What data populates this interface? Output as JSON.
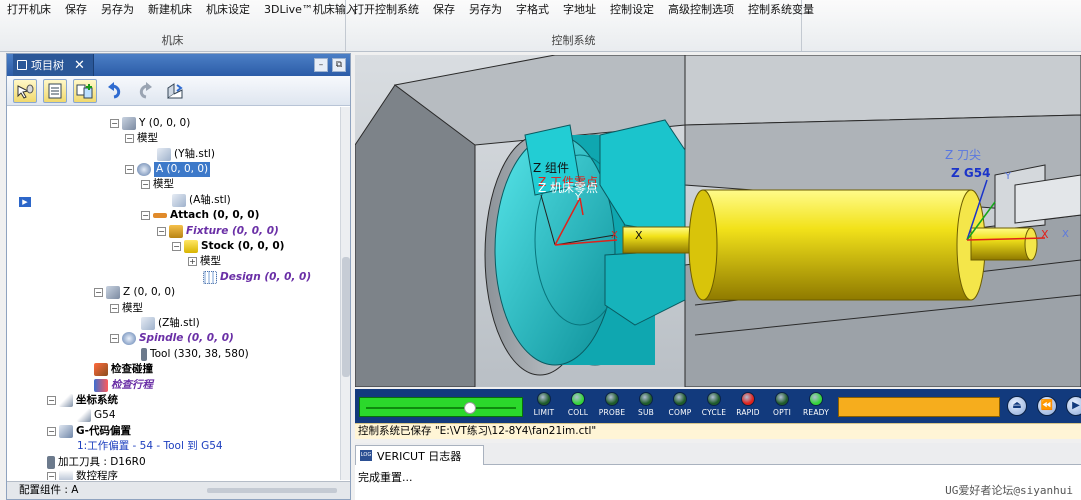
{
  "ribbon": {
    "machine_buttons": [
      "打开机床",
      "保存",
      "另存为",
      "新建机床",
      "机床设定",
      "3DLive™机床输入"
    ],
    "machine_caption": "机床",
    "control_buttons": [
      "打开控制系统",
      "保存",
      "另存为",
      "字格式",
      "字地址",
      "控制设定",
      "高级控制选项",
      "控制系统变量"
    ],
    "control_caption": "控制系统"
  },
  "left_panel": {
    "title": "项目树",
    "close": "✕",
    "tree": [
      {
        "label": "Y (0, 0, 0)"
      },
      {
        "label": "模型"
      },
      {
        "label": "(Y轴.stl)"
      },
      {
        "label": "A (0, 0, 0)"
      },
      {
        "label": "模型"
      },
      {
        "label": "(A轴.stl)"
      },
      {
        "label": "Attach (0, 0, 0)"
      },
      {
        "label": "Fixture (0, 0, 0)"
      },
      {
        "label": "Stock (0, 0, 0)"
      },
      {
        "label": "模型"
      },
      {
        "label": "Design (0, 0, 0)"
      },
      {
        "label": "Z (0, 0, 0)"
      },
      {
        "label": "模型"
      },
      {
        "label": "(Z轴.stl)"
      },
      {
        "label": "Spindle (0, 0, 0)"
      },
      {
        "label": "Tool (330, 38, 580)"
      },
      {
        "label": "检查碰撞"
      },
      {
        "label": "检查行程"
      },
      {
        "label": "坐标系统"
      },
      {
        "label": "G54"
      },
      {
        "label": "G-代码偏置"
      },
      {
        "label": "1:工作偏置 - 54 - Tool 到 G54"
      },
      {
        "label": "加工刀具 : D16R0"
      },
      {
        "label": "数控程序"
      }
    ],
    "status": "配置组件 : A"
  },
  "viewport": {
    "labels": [
      "Z 组件",
      "Z 工件零点",
      "Z 机床零点",
      "Y",
      "X",
      "X",
      "Z 刀尖",
      "Z G54",
      "Y",
      "X",
      "X"
    ]
  },
  "sim_toolbar": {
    "leds": [
      {
        "label": "LIMIT",
        "color": "#1f5b2a"
      },
      {
        "label": "COLL",
        "color": "#35d43a"
      },
      {
        "label": "PROBE",
        "color": "#1f5b2a"
      },
      {
        "label": "SUB",
        "color": "#1f5b2a"
      },
      {
        "label": "COMP",
        "color": "#1f5b2a"
      },
      {
        "label": "CYCLE",
        "color": "#1f5b2a"
      },
      {
        "label": "RAPID",
        "color": "#e0221b"
      },
      {
        "label": "OPTI",
        "color": "#1f5b2a"
      },
      {
        "label": "READY",
        "color": "#35d43a"
      }
    ],
    "slider_value": 0.7
  },
  "save_status": "控制系统已保存 \"E:\\VT练习\\12-8Y4\\fan21im.ctl\"",
  "log": {
    "tab_label": "VERICUT 日志器",
    "logo": "LOG",
    "message": "完成重置..."
  },
  "watermark": "UG爱好者论坛@siyanhui"
}
